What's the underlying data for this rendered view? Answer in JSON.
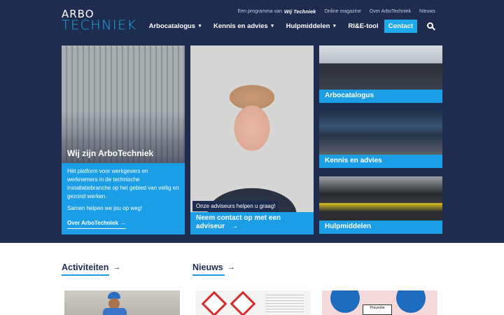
{
  "logo": {
    "line1": "ARBO",
    "line2": "TECHNIEK"
  },
  "toplinks": {
    "programme_prefix": "Een programma van",
    "programme_brand": "Wij Techniek",
    "items": [
      "Online magazine",
      "Over ArboTechniek",
      "Nieuws"
    ]
  },
  "nav": {
    "items": [
      {
        "label": "Arbocatalogus",
        "caret": "▼"
      },
      {
        "label": "Kennis en advies",
        "caret": "▼"
      },
      {
        "label": "Hulpmiddelen",
        "caret": "▼"
      },
      {
        "label": "RI&E-tool"
      }
    ],
    "contact": "Contact",
    "search_icon": "search-icon"
  },
  "tiles": {
    "left": {
      "title": "Wij zijn ArboTechniek",
      "text1": "Hét platform voor werkgevers en werknemers in de technische installatiebranche op het gebied van veilig en gezond werken.",
      "text2": "Samen helpen we jou op weg!",
      "link": "Over ArboTechniek",
      "link_arrow": "→"
    },
    "middle": {
      "tag": "Onze adviseurs helpen u graag!",
      "cta": "Neem contact op met een adviseur",
      "cta_arrow": "→"
    },
    "right": [
      {
        "label": "Arbocatalogus"
      },
      {
        "label": "Kennis en advies"
      },
      {
        "label": "Hulpmiddelen"
      }
    ]
  },
  "sections": [
    {
      "title": "Activiteiten",
      "arrow": "→"
    },
    {
      "title": "Nieuws",
      "arrow": "→"
    }
  ],
  "cards": {
    "sign_text": "Preventie"
  },
  "colors": {
    "navy": "#1e2d4f",
    "accent": "#1c9ee6"
  }
}
